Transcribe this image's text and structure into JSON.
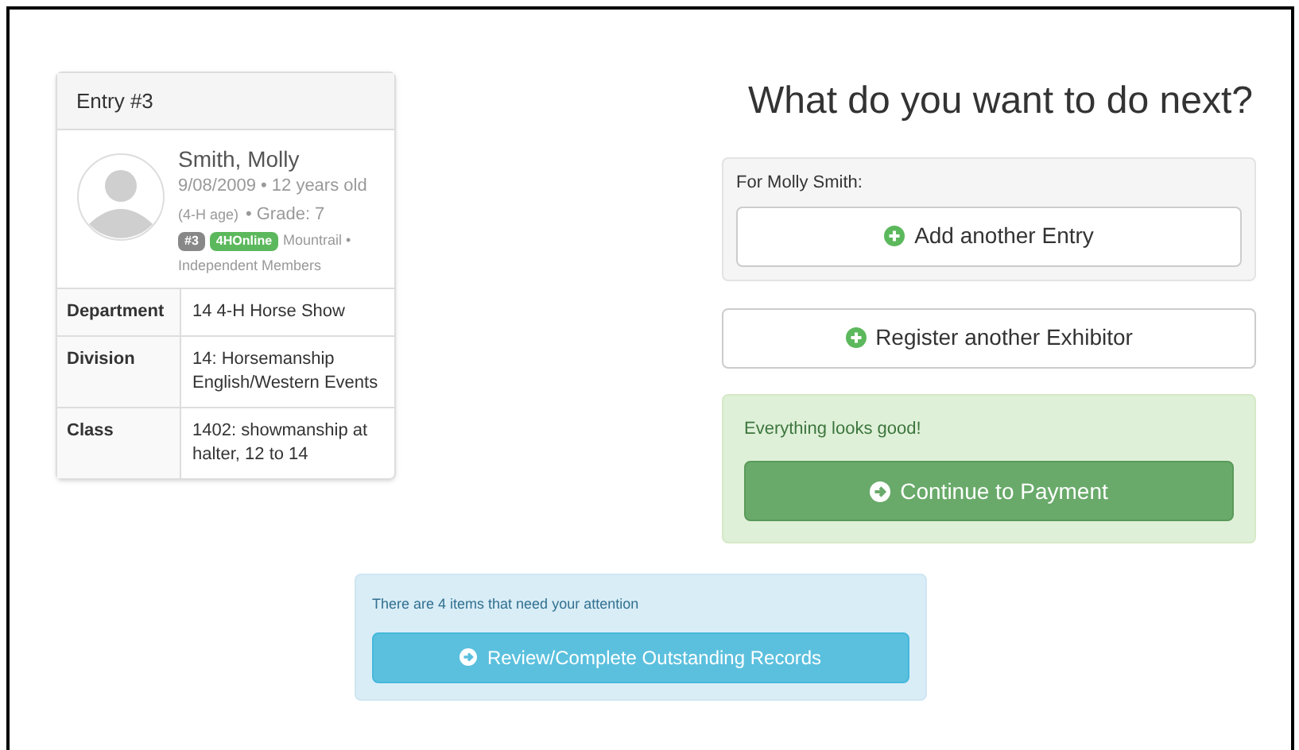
{
  "entry": {
    "title": "Entry #3",
    "name": "Smith, Molly",
    "dob": "9/08/2009 • 12 years old",
    "age_note": "(4-H age)",
    "grade": "• Grade: 7",
    "badges": [
      {
        "label": "#3",
        "color": "#888888"
      },
      {
        "label": "4HOnline",
        "color": "#5cb85c"
      }
    ],
    "county": "Mountrail •",
    "club": "Independent Members",
    "rows": [
      {
        "label": "Department",
        "value": "14 4-H Horse Show"
      },
      {
        "label": "Division",
        "value": "14: Horsemanship English/Western Events"
      },
      {
        "label": "Class",
        "value": "1402: showmanship at halter, 12 to 14"
      }
    ]
  },
  "heading": "What do you want to do next?",
  "for_label": "For Molly Smith:",
  "add_button": "Add another Entry",
  "register_button": "Register another Exhibitor",
  "success": {
    "message": "Everything looks good!",
    "button": "Continue to Payment"
  },
  "attention": {
    "message": "There are 4 items that need your attention",
    "button": "Review/Complete Outstanding Records"
  }
}
